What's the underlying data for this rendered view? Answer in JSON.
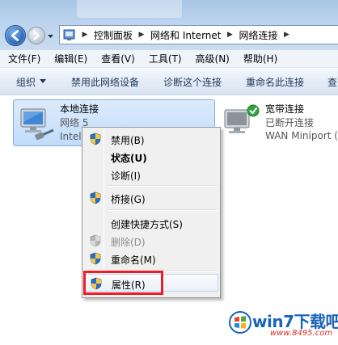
{
  "address": {
    "crumbs": [
      "控制面板",
      "网络和 Internet",
      "网络连接"
    ],
    "separator": "▶"
  },
  "menubar": {
    "items": [
      "文件(F)",
      "编辑(E)",
      "查看(V)",
      "工具(T)",
      "高级(N)",
      "帮助(H)"
    ]
  },
  "toolbar": {
    "organize": "组织",
    "disable": "禁用此网络设备",
    "diagnose": "诊断这个连接",
    "rename": "重命名此连接",
    "more": "查"
  },
  "connections": {
    "local": {
      "name": "本地连接",
      "status": "网络  5",
      "device": "Intel"
    },
    "broadband": {
      "name": "宽带连接",
      "status": "已断开连接",
      "device": "WAN Miniport (PPPOE)"
    }
  },
  "context_menu": {
    "disable": "禁用(B)",
    "status": "状态(U)",
    "diagnose": "诊断(I)",
    "bridge": "桥接(G)",
    "shortcut": "创建快捷方式(S)",
    "delete": "删除(D)",
    "rename": "重命名(M)",
    "properties": "属性(R)"
  },
  "watermark": {
    "text": "win7下载吧",
    "url": "www.8495.com"
  },
  "colors": {
    "highlight": "#ee1c25",
    "accent": "#1a64b7"
  }
}
